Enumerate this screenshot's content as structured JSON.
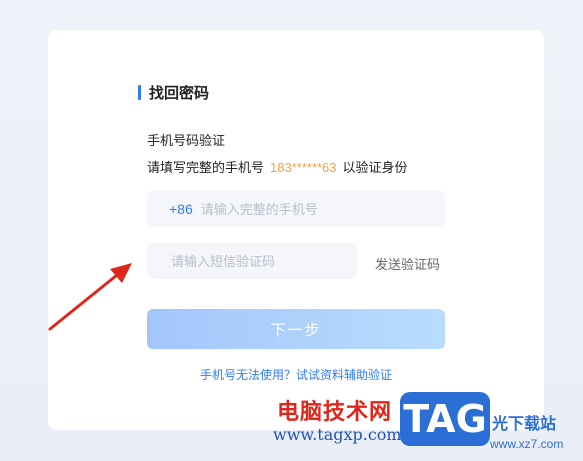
{
  "card": {
    "title": "找回密码",
    "subhead": "手机号码验证",
    "desc_prefix": "请填写完整的手机号",
    "masked_phone": "183******63",
    "desc_suffix": "以验证身份",
    "country_code": "+86",
    "phone_placeholder": "请输入完整的手机号",
    "code_placeholder": "请输入短信验证码",
    "send_code_label": "发送验证码",
    "next_label": "下一步",
    "alt_link": "手机号无法使用？试试资料辅助验证"
  },
  "watermark": {
    "site_name": "电脑技术网",
    "site_url": "www.tagxp.com",
    "badge": "TAG",
    "site_name2": "光下载站",
    "site_url2": "www.xz7.com"
  },
  "colors": {
    "accent": "#2f7cf6",
    "masked_phone": "#f0a24a",
    "arrow": "#e0261b"
  }
}
